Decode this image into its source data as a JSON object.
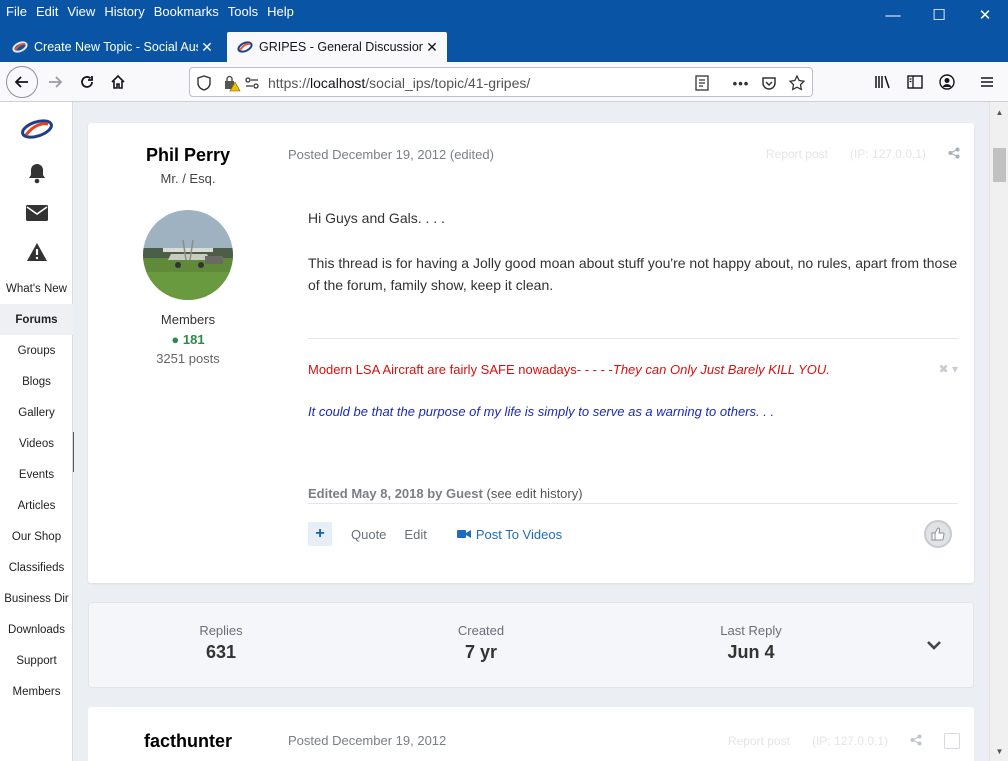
{
  "menu": [
    "File",
    "Edit",
    "View",
    "History",
    "Bookmarks",
    "Tools",
    "Help"
  ],
  "tabs": [
    {
      "title": "Create New Topic - Social Austr",
      "active": false
    },
    {
      "title": "GRIPES - General Discussion - S",
      "active": true
    }
  ],
  "address": {
    "prefix": "https://",
    "host": "localhost",
    "path": "/social_ips/topic/41-gripes/"
  },
  "sidebar": {
    "items": [
      "What's New",
      "Forums",
      "Groups",
      "Blogs",
      "Gallery",
      "Videos",
      "Events",
      "Articles",
      "Our Shop",
      "Classifieds",
      "Business Dir",
      "Downloads",
      "Support",
      "Members"
    ],
    "active": "Forums"
  },
  "post": {
    "author": "Phil Perry",
    "author_title": "Mr. / Esq.",
    "group": "Members",
    "reputation": "181",
    "post_count": "3251 posts",
    "posted": "Posted December 19, 2012 (edited)",
    "report": "Report post",
    "ip": "(IP: 127.0.0.1)",
    "paragraph1": "Hi Guys and Gals. . . .",
    "paragraph2": "This thread is for having a Jolly good moan about stuff you're not happy about, no rules, apart from those of the forum, family show, keep it clean.",
    "signature_red_normal": "Modern LSA Aircraft are fairly SAFE nowadays- - - - -",
    "signature_red_italic": "They can Only Just Barely KILL YOU.",
    "signature_blue": "It could be that the purpose of my life is simply to serve as a warning to others. . .",
    "edited_prefix": "Edited May 8, 2018 by Guest",
    "edited_link": "(see edit history)",
    "quote": "Quote",
    "edit": "Edit",
    "post_to_videos": "Post To Videos"
  },
  "stats": {
    "replies_label": "Replies",
    "replies": "631",
    "created_label": "Created",
    "created": "7 yr",
    "last_reply_label": "Last Reply",
    "last_reply": "Jun 4"
  },
  "post2": {
    "author": "facthunter",
    "posted": "Posted December 19, 2012",
    "report": "Report post",
    "ip": "(IP: 127.0.0.1)"
  }
}
